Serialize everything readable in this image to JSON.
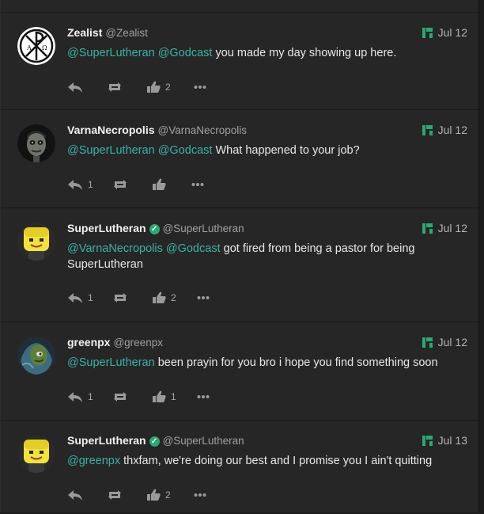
{
  "posts": [
    {
      "name": "Zealist",
      "handle": "@Zealist",
      "verified": false,
      "date": "Jul 12",
      "mentions": [
        "@SuperLutheran",
        "@Godcast"
      ],
      "text": "you made my day showing up here.",
      "reply_count": "",
      "fav_count": "2",
      "avatar": "chi-rho-avatar"
    },
    {
      "name": "VarnaNecropolis",
      "handle": "@VarnaNecropolis",
      "verified": false,
      "date": "Jul 12",
      "mentions": [
        "@SuperLutheran",
        "@Godcast"
      ],
      "text": "What happened to your job?",
      "reply_count": "1",
      "fav_count": "",
      "avatar": "zombie-avatar"
    },
    {
      "name": "SuperLutheran",
      "handle": "@SuperLutheran",
      "verified": true,
      "date": "Jul 12",
      "mentions": [
        "@VarnaNecropolis",
        "@Godcast"
      ],
      "text": "got fired from being a pastor for being SuperLutheran",
      "reply_count": "1",
      "fav_count": "2",
      "avatar": "yellow-smiley-avatar"
    },
    {
      "name": "greenpx",
      "handle": "@greenpx",
      "verified": false,
      "date": "Jul 12",
      "mentions": [
        "@SuperLutheran"
      ],
      "text": "been prayin for you bro i hope you find something soon",
      "reply_count": "1",
      "fav_count": "1",
      "avatar": "green-creature-avatar"
    },
    {
      "name": "SuperLutheran",
      "handle": "@SuperLutheran",
      "verified": true,
      "date": "Jul 13",
      "mentions": [
        "@greenpx"
      ],
      "text": "thxfam, we're doing our best and I promise you I ain't quitting",
      "reply_count": "",
      "fav_count": "2",
      "avatar": "yellow-smiley-avatar"
    }
  ],
  "colors": {
    "mention": "#3ab3a6",
    "accent": "#2aa876",
    "background": "#262626"
  }
}
